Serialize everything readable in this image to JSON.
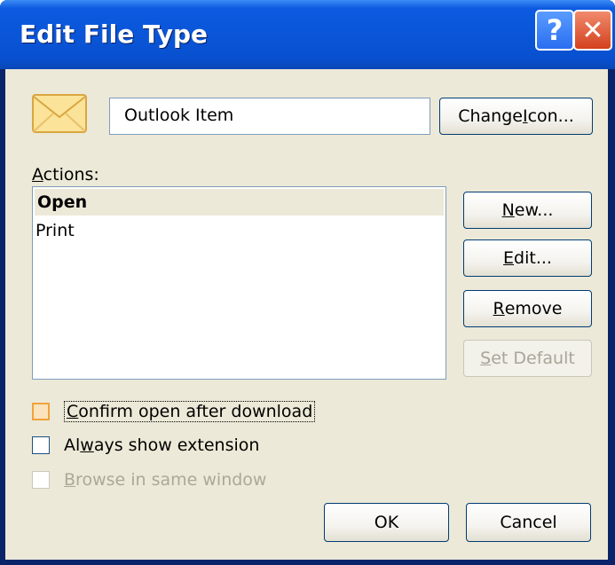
{
  "window": {
    "title": "Edit File Type",
    "help_label": "?",
    "close_label": "✕"
  },
  "file_type": {
    "name_value": "Outlook Item",
    "icon": "envelope-icon"
  },
  "buttons": {
    "change_icon": {
      "pre": "Change ",
      "acc": "I",
      "post": "con..."
    },
    "new": {
      "pre": "",
      "acc": "N",
      "post": "ew..."
    },
    "edit": {
      "pre": "",
      "acc": "E",
      "post": "dit..."
    },
    "remove": {
      "pre": "",
      "acc": "R",
      "post": "emove"
    },
    "set_default": {
      "pre": "",
      "acc": "S",
      "post": "et Default"
    },
    "ok": "OK",
    "cancel": "Cancel"
  },
  "actions": {
    "label": {
      "pre": "",
      "acc": "A",
      "post": "ctions:"
    },
    "items": [
      {
        "label": "Open",
        "selected": true
      },
      {
        "label": "Print",
        "selected": false
      }
    ]
  },
  "options": {
    "confirm_open": {
      "pre": "",
      "acc": "C",
      "post": "onfirm open after download",
      "checked": false
    },
    "always_show_ext": {
      "pre": "Al",
      "acc": "w",
      "post": "ays show extension",
      "checked": false
    },
    "browse_same_window": {
      "pre": "",
      "acc": "B",
      "post": "rowse in same window",
      "checked": false,
      "disabled": true
    }
  },
  "colors": {
    "titlebar": "#0a55d8",
    "dialog_bg": "#ece9d8",
    "button_border": "#003c74",
    "disabled_text": "#aca899"
  }
}
